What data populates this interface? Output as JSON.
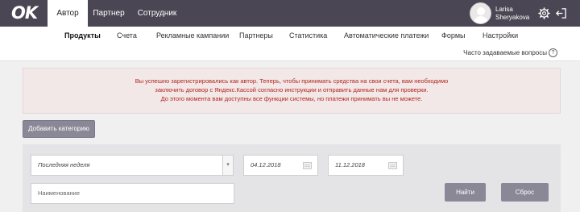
{
  "app": {
    "logo_text": "OK"
  },
  "top_tabs": [
    {
      "label": "Автор",
      "active": true
    },
    {
      "label": "Партнер",
      "active": false
    },
    {
      "label": "Сотрудник",
      "active": false
    }
  ],
  "user": {
    "first_name": "Larisa",
    "last_name": "Sheryakova"
  },
  "top_icons": {
    "settings": "gear-icon",
    "logout": "logout-icon"
  },
  "subnav": [
    {
      "label": "Продукты",
      "active": true
    },
    {
      "label": "Счета",
      "active": false
    },
    {
      "label": "Рекламные кампании",
      "active": false
    },
    {
      "label": "Партнеры",
      "active": false
    },
    {
      "label": "Статистика",
      "active": false
    },
    {
      "label": "Автоматические платежи",
      "active": false
    },
    {
      "label": "Формы",
      "active": false
    },
    {
      "label": "Настройки",
      "active": false
    }
  ],
  "help": {
    "label": "Часто задаваемые вопросы",
    "icon_glyph": "?"
  },
  "notice": {
    "lines": [
      "Вы успешно зарегистрировались как автор. Теперь, чтобы принимать средства на свои счета, вам необходимо",
      "заключить договор с Яндекс.Кассой согласно инструкции и отправить данные нам для проверки.",
      "До этого момента вам доступны все функции системы, но платежи принимать вы не можете."
    ],
    "color": "#b3261e"
  },
  "buttons": {
    "add_category": "Добавить категорию",
    "find": "Найти",
    "reset": "Сброс"
  },
  "filters": {
    "period_selected": "Последняя неделя",
    "date_from": "04.12.2018",
    "date_to": "11.12.2018",
    "name_placeholder": "Наименование"
  },
  "colors": {
    "topbar": "#4a4653",
    "button": "#8a8796"
  }
}
